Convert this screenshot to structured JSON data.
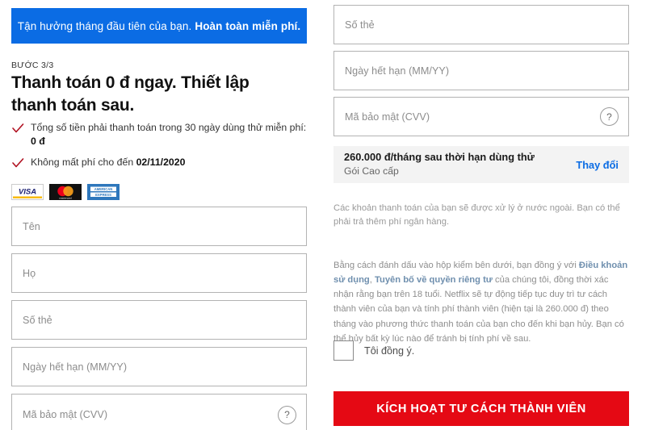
{
  "promo": {
    "text_normal": "Tận hưởng tháng đầu tiên của bạn.",
    "text_bold": "Hoàn toàn miễn phí.",
    "bg_color": "#0b6ce4"
  },
  "step": {
    "label": "BƯỚC 3/3",
    "headline": "Thanh toán 0 đ ngay. Thiết lập thanh toán sau."
  },
  "benefits": [
    {
      "icon": "check-icon",
      "text_before": "Tổng số tiền phải thanh toán trong 30 ngày dùng thử miễn phí: ",
      "text_bold": "0 đ"
    },
    {
      "icon": "check-icon",
      "text_before": "Không mất phí cho đến ",
      "text_bold": "02/11/2020"
    }
  ],
  "card_logos": [
    {
      "name": "visa-logo",
      "label": "VISA"
    },
    {
      "name": "mastercard-logo",
      "label": "mastercard"
    },
    {
      "name": "amex-logo",
      "label": "AMERICAN EXPRESS"
    }
  ],
  "left_form": {
    "fields": [
      {
        "name": "first-name-input",
        "placeholder": "Tên",
        "value": ""
      },
      {
        "name": "last-name-input",
        "placeholder": "Họ",
        "value": ""
      },
      {
        "name": "card-number-input",
        "placeholder": "Số thẻ",
        "value": ""
      },
      {
        "name": "expiry-date-input",
        "placeholder": "Ngày hết hạn (MM/YY)",
        "value": ""
      },
      {
        "name": "cvv-input",
        "placeholder": "Mã bảo mật (CVV)",
        "value": "",
        "help_icon": "?"
      }
    ]
  },
  "right_form": {
    "fields": [
      {
        "name": "card-number-input",
        "placeholder": "Số thẻ",
        "value": ""
      },
      {
        "name": "expiry-date-input",
        "placeholder": "Ngày hết hạn (MM/YY)",
        "value": ""
      },
      {
        "name": "cvv-input",
        "placeholder": "Mã bảo mật (CVV)",
        "value": "",
        "help_icon": "?"
      }
    ]
  },
  "plan_box": {
    "price_line": "260.000 đ/tháng sau thời hạn dùng thử",
    "plan_name": "Gói Cao cấp",
    "change_link": "Thay đổi",
    "link_color": "#0b6ce4",
    "bg_color": "#f3f3f3"
  },
  "fx_note": {
    "text": "Các khoản thanh toán của bạn sẽ được xử lý ở nước ngoài. Bạn có thể phải trả thêm phí ngân hàng."
  },
  "legal": {
    "part1": "Bằng cách đánh dấu vào hộp kiểm bên dưới, bạn đồng ý với ",
    "link1": "Điều khoản sử dụng",
    "part2": ", ",
    "link2": "Tuyên bố về quyền riêng tư",
    "part3": " của chúng tôi, đồng thời xác nhận rằng bạn trên 18 tuổi. Netflix sẽ tự động tiếp tục duy trì tư cách thành viên của bạn và tính phí thành viên (hiện tại là 260.000 đ) theo tháng vào phương thức thanh toán của bạn cho đến khi bạn hủy. Bạn có thể hủy bất kỳ lúc nào để tránh bị tính phí về sau.",
    "link_color": "#6f8fae"
  },
  "agreement": {
    "checkbox_name": "agree-checkbox",
    "checked": false,
    "label": "Tôi đồng ý."
  },
  "cta": {
    "label": "KÍCH HOẠT TƯ CÁCH THÀNH VIÊN",
    "bg_color": "#e50914"
  }
}
